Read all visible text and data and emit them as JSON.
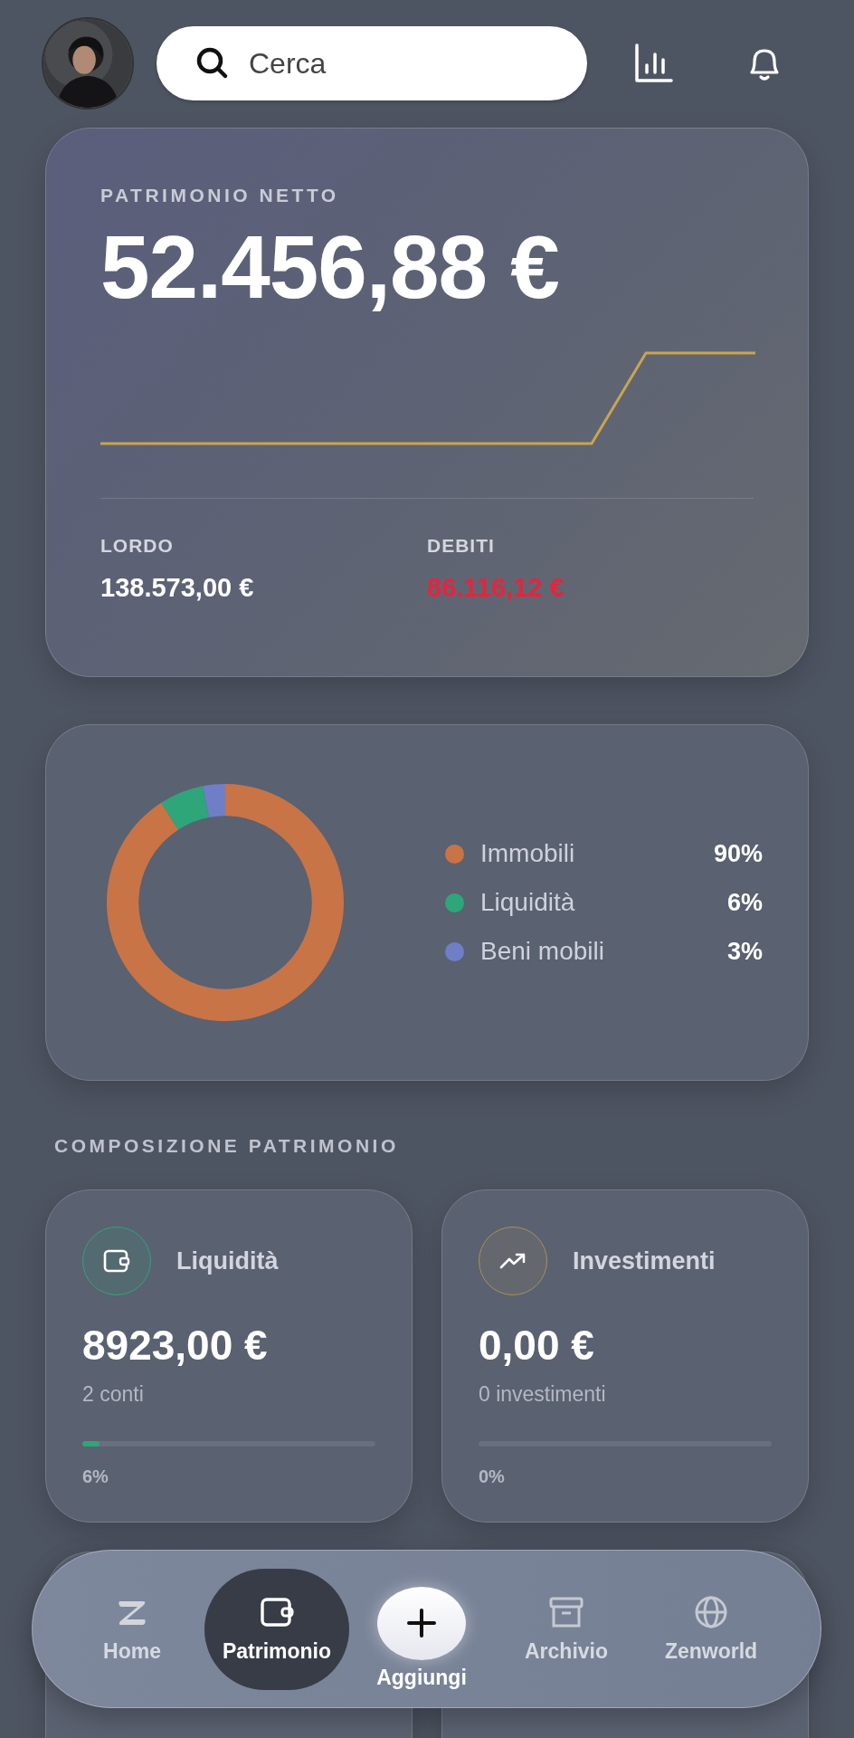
{
  "header": {
    "search": {
      "placeholder": "Cerca"
    }
  },
  "net_worth": {
    "label": "PATRIMONIO NETTO",
    "amount": "52.456,88 €",
    "gross": {
      "label": "LORDO",
      "value": "138.573,00 €"
    },
    "debts": {
      "label": "DEBITI",
      "value": "86.116,12 €"
    }
  },
  "allocation": {
    "chart_data": {
      "type": "donut",
      "values": [
        90,
        6,
        3
      ]
    },
    "legend": [
      {
        "label": "Immobili",
        "value": "90%",
        "color": "#c87447"
      },
      {
        "label": "Liquidità",
        "value": "6%",
        "color": "#2fa57a"
      },
      {
        "label": "Beni mobili",
        "value": "3%",
        "color": "#6f7ec7"
      }
    ]
  },
  "composition": {
    "title": "COMPOSIZIONE PATRIMONIO",
    "cards": [
      {
        "kind": "wallet",
        "title": "Liquidità",
        "amount": "8923,00 €",
        "subtitle": "2 conti",
        "level": 0.06,
        "percent": "6%",
        "color": "#2fa57a"
      },
      {
        "kind": "trend",
        "title": "Investimenti",
        "amount": "0,00 €",
        "subtitle": "0 investimenti",
        "percent": "0%",
        "color": "#a8915c"
      }
    ]
  },
  "bottom_nav": [
    {
      "kind": "logo",
      "label": "Home",
      "selected": false
    },
    {
      "kind": "wallet",
      "label": "Patrimonio",
      "selected": true
    },
    {
      "kind": "add",
      "label": "Aggiungi",
      "selected": false
    },
    {
      "kind": "archive",
      "label": "Archivio",
      "selected": false
    },
    {
      "kind": "globe",
      "label": "Zenworld",
      "selected": false
    }
  ]
}
